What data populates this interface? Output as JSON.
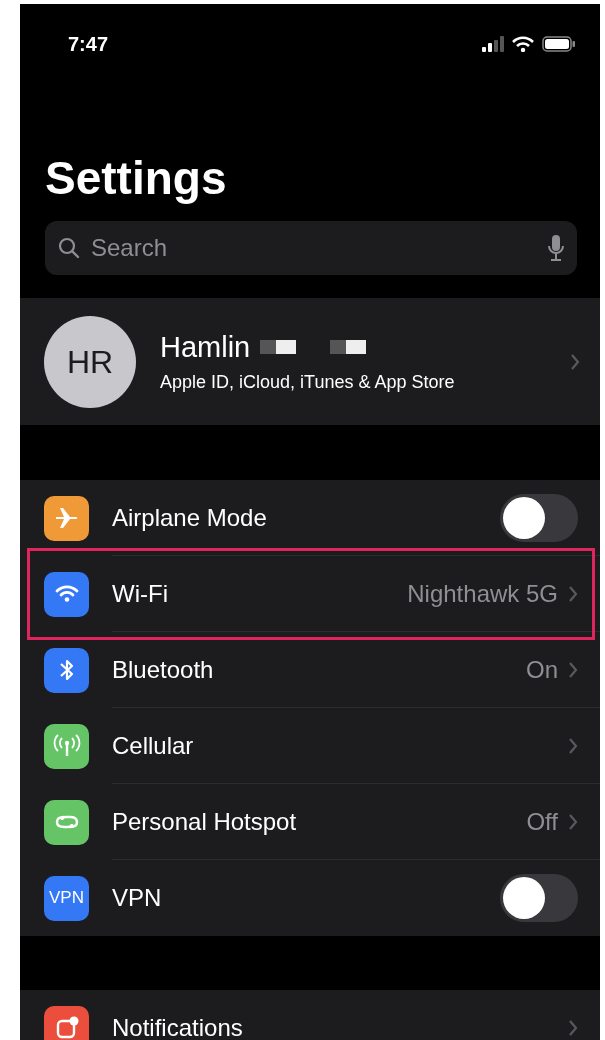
{
  "status_bar": {
    "time": "7:47"
  },
  "title": "Settings",
  "search": {
    "placeholder": "Search"
  },
  "profile": {
    "initials": "HR",
    "name": "Hamlin",
    "subtitle": "Apple ID, iCloud, iTunes & App Store"
  },
  "groups": [
    {
      "rows": [
        {
          "kind": "toggle",
          "label": "Airplane Mode",
          "on": false,
          "highlighted": false,
          "color": "#f09a37"
        },
        {
          "kind": "link",
          "label": "Wi-Fi",
          "value": "Nighthawk 5G",
          "highlighted": true,
          "color": "#3478f6"
        },
        {
          "kind": "link",
          "label": "Bluetooth",
          "value": "On",
          "highlighted": false,
          "color": "#3478f6"
        },
        {
          "kind": "link",
          "label": "Cellular",
          "highlighted": false,
          "color": "#65c466"
        },
        {
          "kind": "link",
          "label": "Personal Hotspot",
          "value": "Off",
          "highlighted": false,
          "color": "#65c466"
        },
        {
          "kind": "toggle",
          "label": "VPN",
          "on": false,
          "highlighted": false,
          "color": "#3478f6",
          "icon_text": "VPN"
        }
      ]
    },
    {
      "rows": [
        {
          "kind": "link",
          "label": "Notifications",
          "highlighted": false,
          "color": "#eb4e3d"
        }
      ]
    }
  ]
}
